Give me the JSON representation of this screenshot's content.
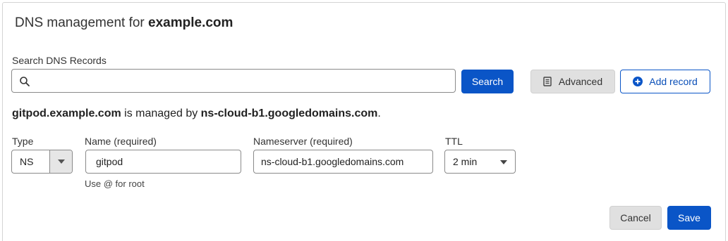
{
  "dialog": {
    "title_prefix": "DNS management for ",
    "title_domain": "example.com"
  },
  "search": {
    "label": "Search DNS Records",
    "value": "",
    "placeholder": "",
    "search_button": "Search",
    "advanced_button": "Advanced",
    "add_record_button": "Add record"
  },
  "info": {
    "subdomain": "gitpod.example.com",
    "middle_text": " is managed by ",
    "nameserver": "ns-cloud-b1.googledomains.com",
    "end": "."
  },
  "form": {
    "type_label": "Type",
    "type_value": "NS",
    "name_label": "Name (required)",
    "name_value": "gitpod",
    "name_hint": "Use @ for root",
    "nameserver_label": "Nameserver (required)",
    "nameserver_value": "ns-cloud-b1.googledomains.com",
    "ttl_label": "TTL",
    "ttl_value": "2 min"
  },
  "actions": {
    "cancel": "Cancel",
    "save": "Save"
  },
  "colors": {
    "primary": "#0a55c7",
    "secondary_button": "#e0e0e0"
  },
  "icons": {
    "search": "magnifier",
    "advanced": "document",
    "add": "plus-circle"
  }
}
